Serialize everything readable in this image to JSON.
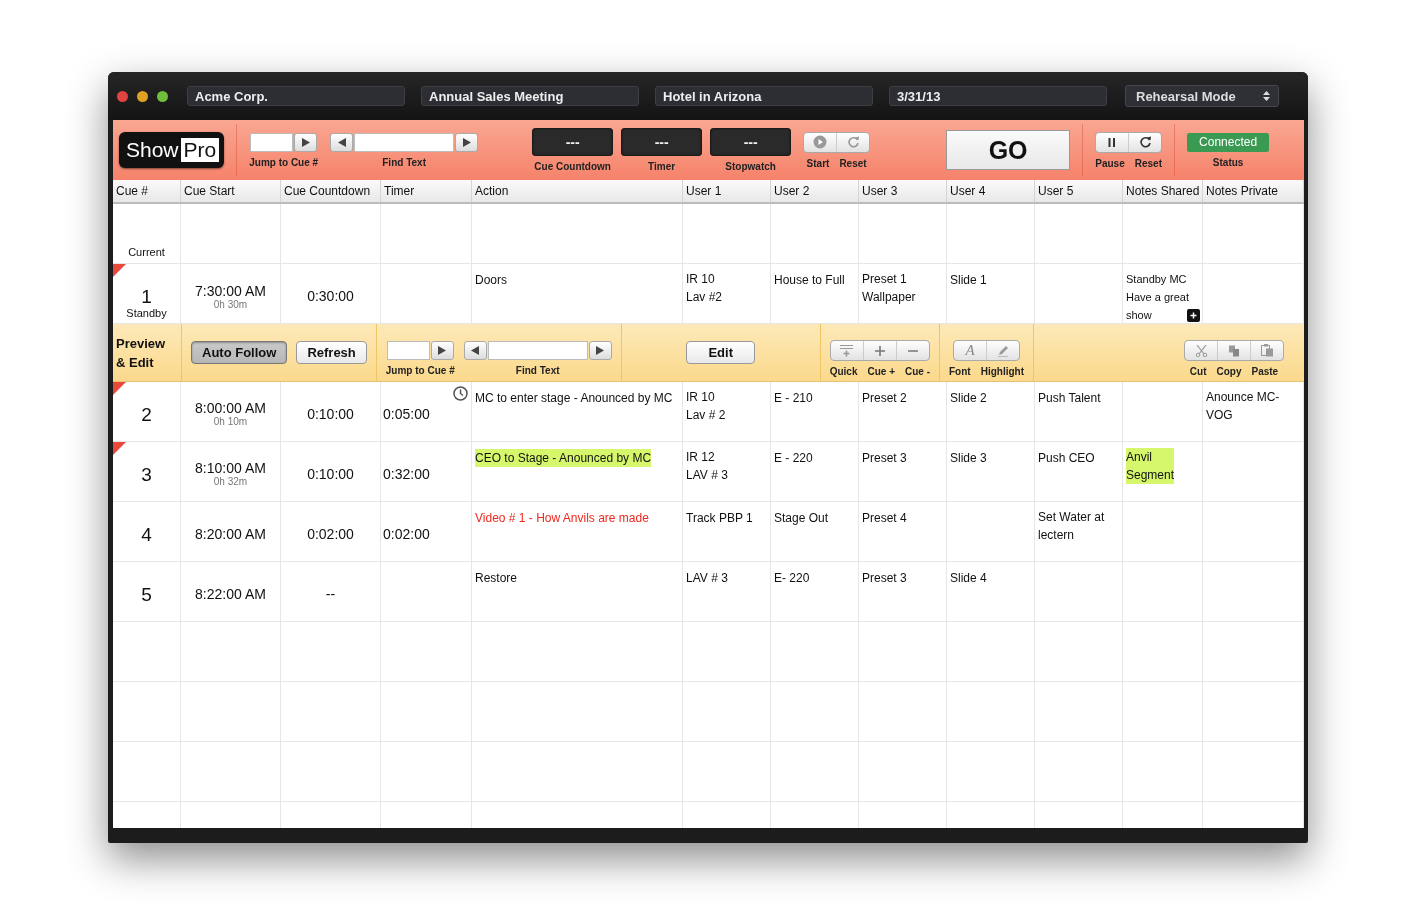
{
  "title_bar": {
    "fields": [
      "Acme Corp.",
      "Annual Sales Meeting",
      "Hotel in Arizona",
      "3/31/13"
    ],
    "mode_select": "Rehearsal Mode"
  },
  "toolbar": {
    "logo": {
      "word_1": "Show",
      "word_2": "Pro"
    },
    "jump_label": "Jump to Cue #",
    "find_label": "Find Text",
    "displays": [
      {
        "value": "---",
        "label": "Cue Countdown"
      },
      {
        "value": "---",
        "label": "Timer"
      },
      {
        "value": "---",
        "label": "Stopwatch"
      }
    ],
    "stopwatch_buttons": [
      "Start",
      "Reset"
    ],
    "go": "GO",
    "pause_buttons": [
      "Pause",
      "Reset"
    ],
    "status": {
      "value": "Connected",
      "label": "Status"
    }
  },
  "columns": [
    "Cue #",
    "Cue Start",
    "Cue Countdown",
    "Timer",
    "Action",
    "User 1",
    "User 2",
    "User 3",
    "User 4",
    "User 5",
    "Notes Shared",
    "Notes Private"
  ],
  "rows_before": [
    {
      "status": "Current",
      "flagged": false
    },
    {
      "cue": "1",
      "status": "Standby",
      "flagged": true,
      "start": "7:30:00 AM",
      "elapsed": "0h 30m",
      "countdown": "0:30:00",
      "action": "Doors",
      "action_highlight": false,
      "action_alert": false,
      "clock": false,
      "user_1": "IR 10\nLav #2",
      "user_2": "House to Full",
      "user_3": "Preset 1\nWallpaper",
      "user_4": "Slide 1",
      "notes_shared": "Standby MC\nHave a great\nshow",
      "notes_highlight": false,
      "notes_more": true
    }
  ],
  "preview_bar": {
    "title": "Preview\n& Edit",
    "toggles": [
      {
        "label": "Auto Follow",
        "selected": true
      },
      {
        "label": "Refresh",
        "selected": false
      }
    ],
    "jump_label": "Jump to Cue #",
    "find_label": "Find Text",
    "edit": "Edit",
    "cue_tools": [
      "Quick",
      "Cue +",
      "Cue -"
    ],
    "font_icon": "A",
    "format_tools": [
      "Font",
      "Highlight"
    ],
    "clipboard_tools": [
      "Cut",
      "Copy",
      "Paste"
    ]
  },
  "rows_after": [
    {
      "cue": "2",
      "flagged": true,
      "start": "8:00:00 AM",
      "elapsed": "0h 10m",
      "countdown": "0:10:00",
      "timer": "0:05:00",
      "action": "MC to enter stage - Anounced by MC",
      "action_highlight": false,
      "action_alert": false,
      "clock": true,
      "user_1": "IR 10\nLav # 2",
      "user_2": "E - 210",
      "user_3": "Preset 2",
      "user_4": "Slide 2",
      "user_5": "Push Talent",
      "notes_highlight": false,
      "notes_more": false,
      "notes_private": "Anounce MC-\nVOG"
    },
    {
      "cue": "3",
      "flagged": true,
      "start": "8:10:00 AM",
      "elapsed": "0h 32m",
      "countdown": "0:10:00",
      "timer": "0:32:00",
      "action": "CEO to Stage - Anounced by MC",
      "action_highlight": true,
      "action_alert": false,
      "clock": false,
      "user_1": "IR 12\nLAV # 3",
      "user_2": "E - 220",
      "user_3": "Preset 3",
      "user_4": "Slide 3",
      "user_5": "Push CEO",
      "notes_shared": "Anvil\nSegment",
      "notes_highlight": true,
      "notes_more": false
    },
    {
      "cue": "4",
      "flagged": false,
      "start": "8:20:00 AM",
      "countdown": "0:02:00",
      "timer": "0:02:00",
      "action": "Video # 1 - How Anvils are made",
      "action_highlight": false,
      "action_alert": true,
      "clock": false,
      "user_1": "Track PBP 1",
      "user_2": "Stage Out",
      "user_3": "Preset 4",
      "user_5": "Set Water at\nlectern",
      "notes_highlight": false,
      "notes_more": false
    },
    {
      "cue": "5",
      "flagged": false,
      "start": "8:22:00 AM",
      "countdown": "--",
      "action": "Restore",
      "action_highlight": false,
      "action_alert": false,
      "clock": false,
      "user_1": "LAV # 3",
      "user_2": "E- 220",
      "user_3": "Preset 3",
      "user_4": "Slide 4",
      "notes_highlight": false,
      "notes_more": false
    }
  ]
}
